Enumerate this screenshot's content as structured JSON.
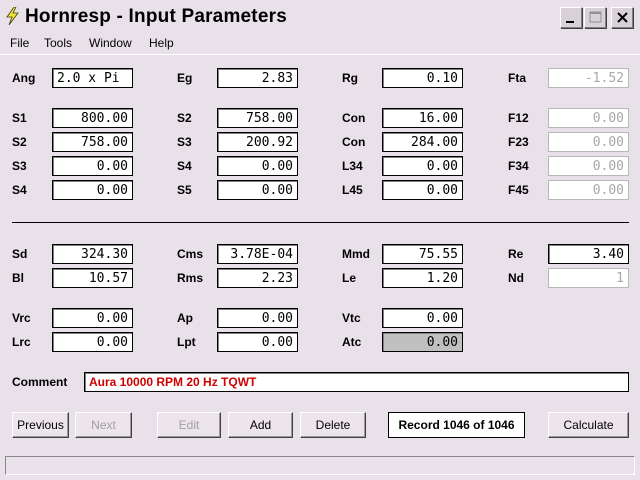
{
  "window": {
    "title": "Hornresp - Input Parameters"
  },
  "menu": [
    "File",
    "Tools",
    "Window",
    "Help"
  ],
  "fields": {
    "ang": {
      "label": "Ang",
      "value": "2.0 x Pi"
    },
    "eg": {
      "label": "Eg",
      "value": "2.83"
    },
    "rg": {
      "label": "Rg",
      "value": "0.10"
    },
    "fta": {
      "label": "Fta",
      "value": "-1.52"
    },
    "s1": {
      "label": "S1",
      "value": "800.00"
    },
    "s2a": {
      "label": "S2",
      "value": "758.00"
    },
    "con1": {
      "label": "Con",
      "value": "16.00"
    },
    "f12": {
      "label": "F12",
      "value": "0.00"
    },
    "s2b": {
      "label": "S2",
      "value": "758.00"
    },
    "s3a": {
      "label": "S3",
      "value": "200.92"
    },
    "con2": {
      "label": "Con",
      "value": "284.00"
    },
    "f23": {
      "label": "F23",
      "value": "0.00"
    },
    "s3b": {
      "label": "S3",
      "value": "0.00"
    },
    "s4a": {
      "label": "S4",
      "value": "0.00"
    },
    "l34": {
      "label": "L34",
      "value": "0.00"
    },
    "f34": {
      "label": "F34",
      "value": "0.00"
    },
    "s4b": {
      "label": "S4",
      "value": "0.00"
    },
    "s5": {
      "label": "S5",
      "value": "0.00"
    },
    "l45": {
      "label": "L45",
      "value": "0.00"
    },
    "f45": {
      "label": "F45",
      "value": "0.00"
    },
    "sd": {
      "label": "Sd",
      "value": "324.30"
    },
    "cms": {
      "label": "Cms",
      "value": "3.78E-04"
    },
    "mmd": {
      "label": "Mmd",
      "value": "75.55"
    },
    "re": {
      "label": "Re",
      "value": "3.40"
    },
    "bl": {
      "label": "Bl",
      "value": "10.57"
    },
    "rms": {
      "label": "Rms",
      "value": "2.23"
    },
    "le": {
      "label": "Le",
      "value": "1.20"
    },
    "nd": {
      "label": "Nd",
      "value": "1"
    },
    "vrc": {
      "label": "Vrc",
      "value": "0.00"
    },
    "ap": {
      "label": "Ap",
      "value": "0.00"
    },
    "vtc": {
      "label": "Vtc",
      "value": "0.00"
    },
    "lrc": {
      "label": "Lrc",
      "value": "0.00"
    },
    "lpt": {
      "label": "Lpt",
      "value": "0.00"
    },
    "atc": {
      "label": "Atc",
      "value": "0.00"
    }
  },
  "comment": {
    "label": "Comment",
    "value": "Aura 10000 RPM 20 Hz TQWT"
  },
  "buttons": {
    "previous": "Previous",
    "next": "Next",
    "edit": "Edit",
    "add": "Add",
    "delete": "Delete",
    "calculate": "Calculate"
  },
  "record": "Record 1046 of 1046",
  "colors": {
    "background": "#e9e1e9",
    "comment_text": "#d00000",
    "disabled_text": "#a0a0a0"
  }
}
